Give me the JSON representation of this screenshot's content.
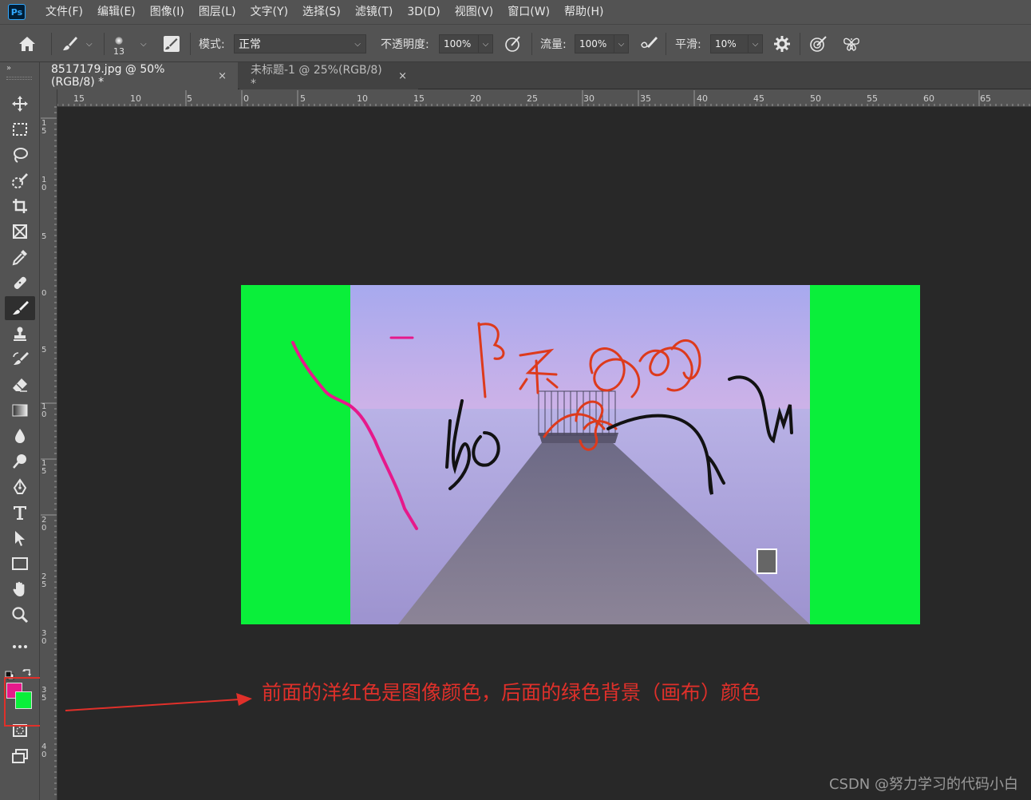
{
  "app": {
    "logo": "Ps"
  },
  "menu": [
    "文件(F)",
    "编辑(E)",
    "图像(I)",
    "图层(L)",
    "文字(Y)",
    "选择(S)",
    "滤镜(T)",
    "3D(D)",
    "视图(V)",
    "窗口(W)",
    "帮助(H)"
  ],
  "options": {
    "brush_size": "13",
    "mode_label": "模式:",
    "mode_value": "正常",
    "opacity_label": "不透明度:",
    "opacity_value": "100%",
    "flow_label": "流量:",
    "flow_value": "100%",
    "smoothing_label": "平滑:",
    "smoothing_value": "10%"
  },
  "tabs": [
    {
      "label": "8517179.jpg @ 50%(RGB/8) *",
      "close": "×"
    },
    {
      "label": "未标题-1 @ 25%(RGB/8) *",
      "close": "×"
    }
  ],
  "ruler_h": [
    "15",
    "10",
    "5",
    "0",
    "5",
    "10",
    "15",
    "20",
    "25",
    "30",
    "35",
    "40",
    "45",
    "50",
    "55",
    "60",
    "65"
  ],
  "ruler_v": [
    "15",
    "10",
    "5",
    "0",
    "5",
    "10",
    "15",
    "20",
    "25",
    "30",
    "35",
    "40"
  ],
  "colors": {
    "foreground": "#e6198b",
    "background": "#0aef3a",
    "annotation": "#e0302a"
  },
  "annotation": {
    "text": "前面的洋红色是图像颜色，后面的绿色背景（画布）颜色"
  },
  "watermark": "CSDN @努力学习的代码小白",
  "toolbar_icons": [
    "move-icon",
    "marquee-icon",
    "lasso-icon",
    "quick-select-icon",
    "crop-icon",
    "frame-icon",
    "eyedropper-icon",
    "healing-icon",
    "brush-icon",
    "stamp-icon",
    "history-brush-icon",
    "eraser-icon",
    "gradient-icon",
    "blur-icon",
    "dodge-icon",
    "pen-icon",
    "type-icon",
    "path-select-icon",
    "rectangle-icon",
    "hand-icon",
    "zoom-icon",
    "more-icon"
  ]
}
